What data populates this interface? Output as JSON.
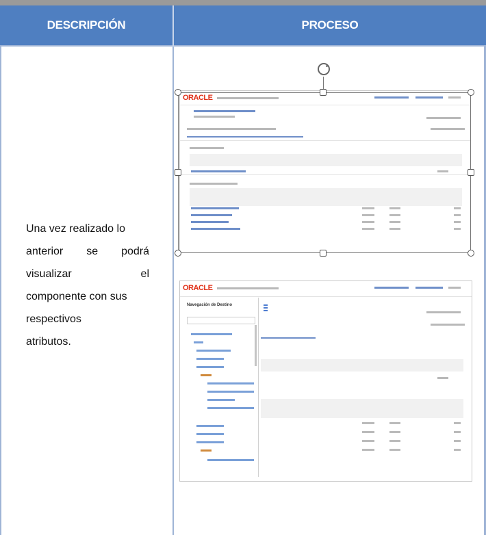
{
  "table": {
    "col_description": "DESCRIPCIÓN",
    "col_process": "PROCESO"
  },
  "row": {
    "description": {
      "line1": "Una vez realizado lo",
      "line2": "anterior se podrá",
      "line3": "visualizar el",
      "line4": "componente con sus",
      "line5": "respectivos",
      "line6": "atributos."
    }
  },
  "screenshots": {
    "top": {
      "logo": "ORACLE"
    },
    "bottom": {
      "logo": "ORACLE",
      "panel_title": "Navegación de Destino"
    }
  },
  "colors": {
    "header": "#4f7fc1",
    "grid": "#9fb4d6",
    "oracle_red": "#e03018"
  }
}
